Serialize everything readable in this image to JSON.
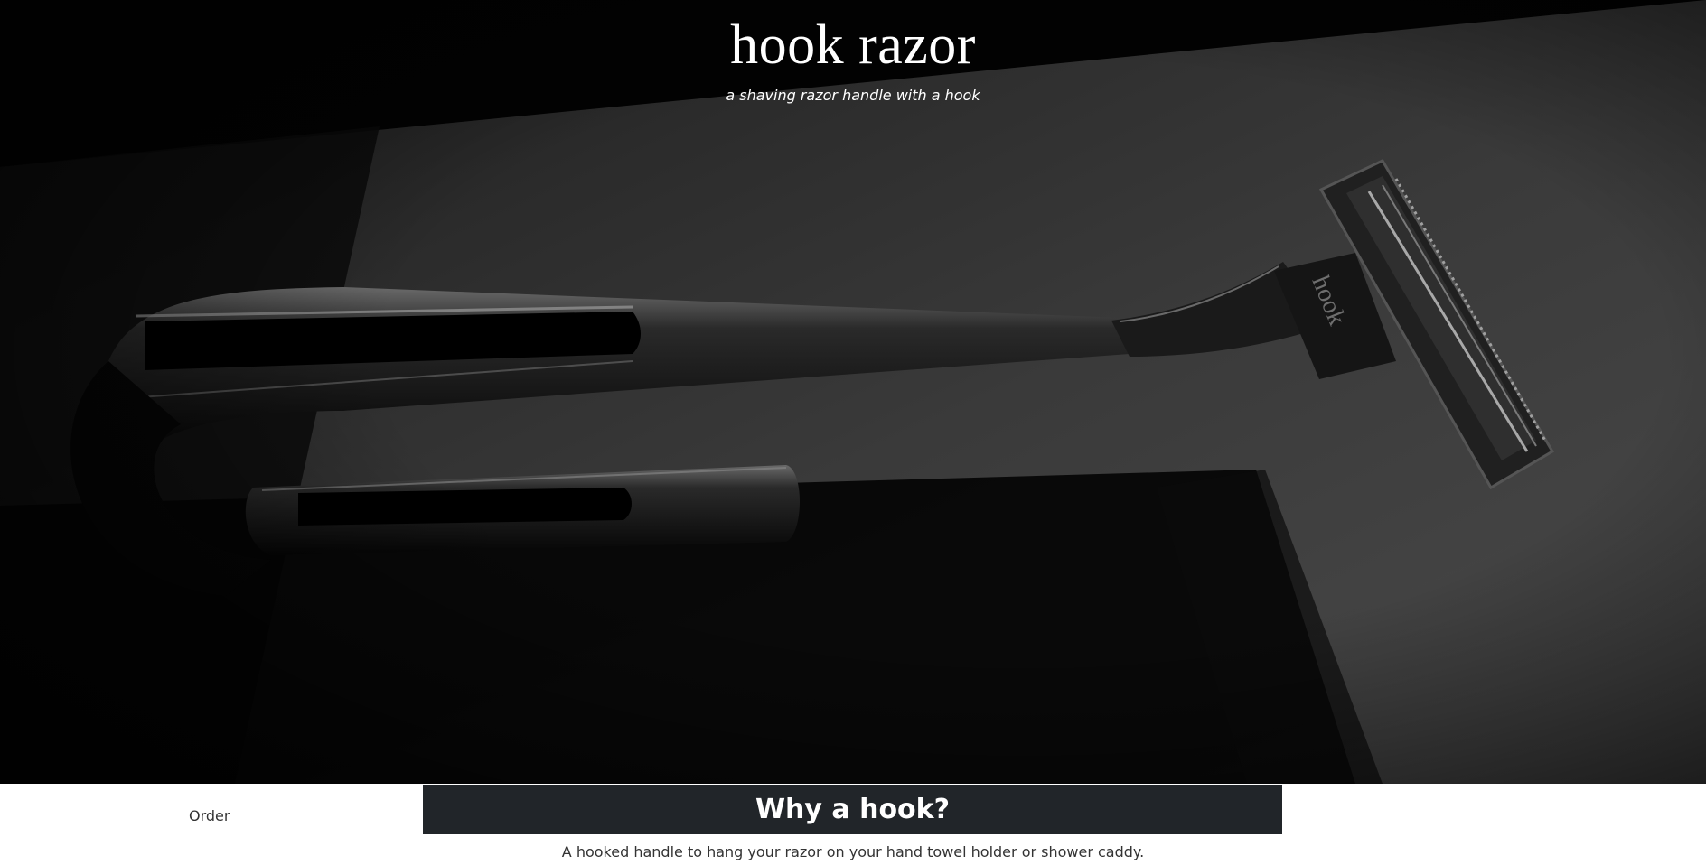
{
  "hero": {
    "title": "hook razor",
    "subtitle": "a shaving razor handle with a hook",
    "image_subject": "razor-handle-with-hook-photo",
    "engraving": "hook"
  },
  "nav": {
    "order_label": "Order"
  },
  "section": {
    "heading": "Why a hook?",
    "body": "A hooked handle to hang your razor on your hand towel holder or shower caddy.",
    "header_bg": "#212529"
  },
  "colors": {
    "hero_bg": "#000000",
    "page_bg": "#ffffff",
    "text": "#333333"
  }
}
